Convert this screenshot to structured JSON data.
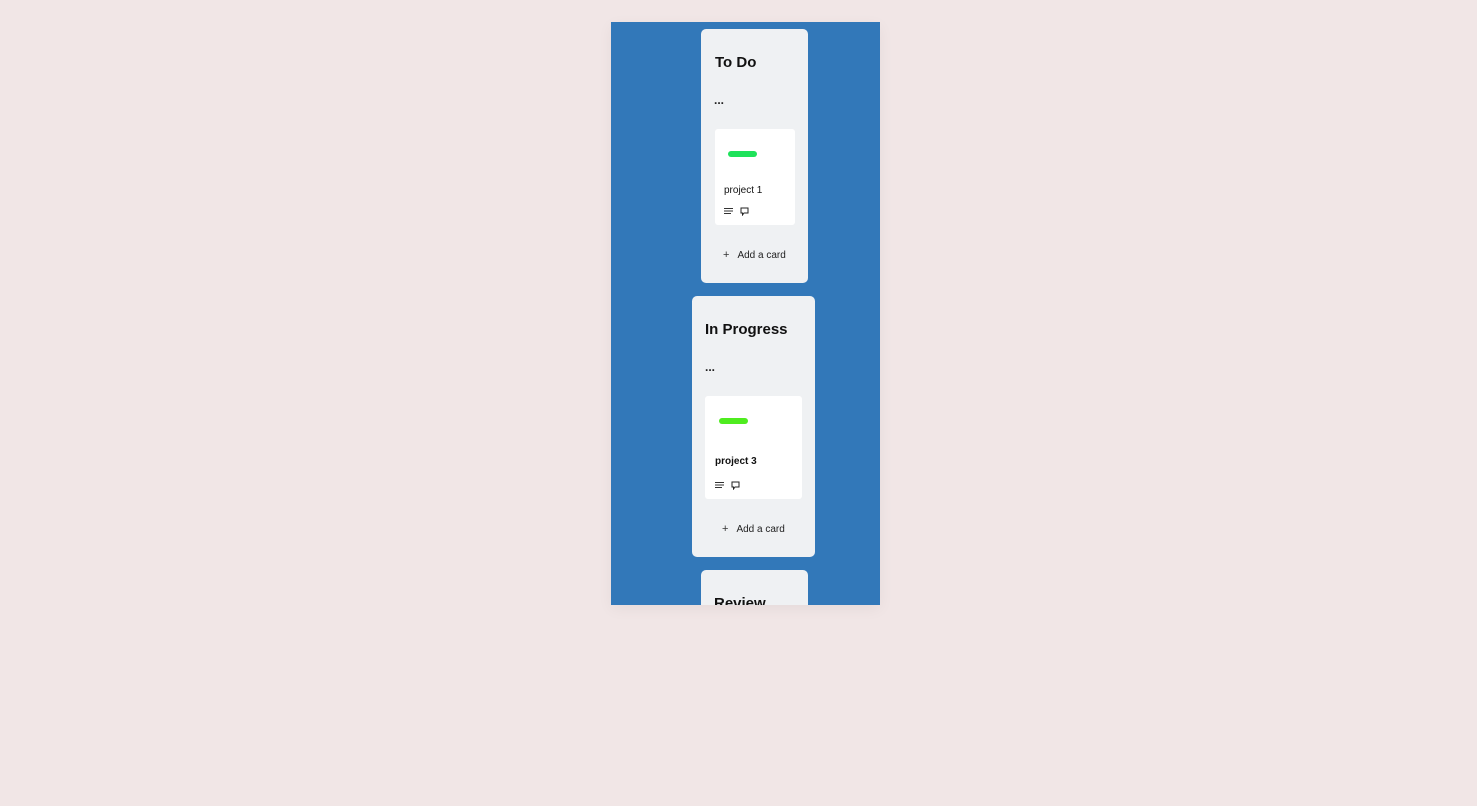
{
  "colors": {
    "page_background": "#f1e6e6",
    "board_background": "#3278b9",
    "list_background": "#eff1f3",
    "label_green_1": "#1ee25a",
    "label_green_2": "#4fec1f"
  },
  "lists": [
    {
      "title": "To Do",
      "menu": "...",
      "cards": [
        {
          "label_color": "#1ee25a",
          "title": "project 1",
          "icons": [
            "description-icon",
            "comment-icon"
          ]
        }
      ],
      "add_card_icon": "plus-icon",
      "add_card_label": "Add a card"
    },
    {
      "title": "In Progress",
      "menu": "...",
      "cards": [
        {
          "label_color": "#4fec1f",
          "title": "project 3",
          "icons": [
            "description-icon",
            "comment-icon"
          ]
        }
      ],
      "add_card_icon": "plus-icon",
      "add_card_label": "Add a card"
    },
    {
      "title": "Review"
    }
  ]
}
